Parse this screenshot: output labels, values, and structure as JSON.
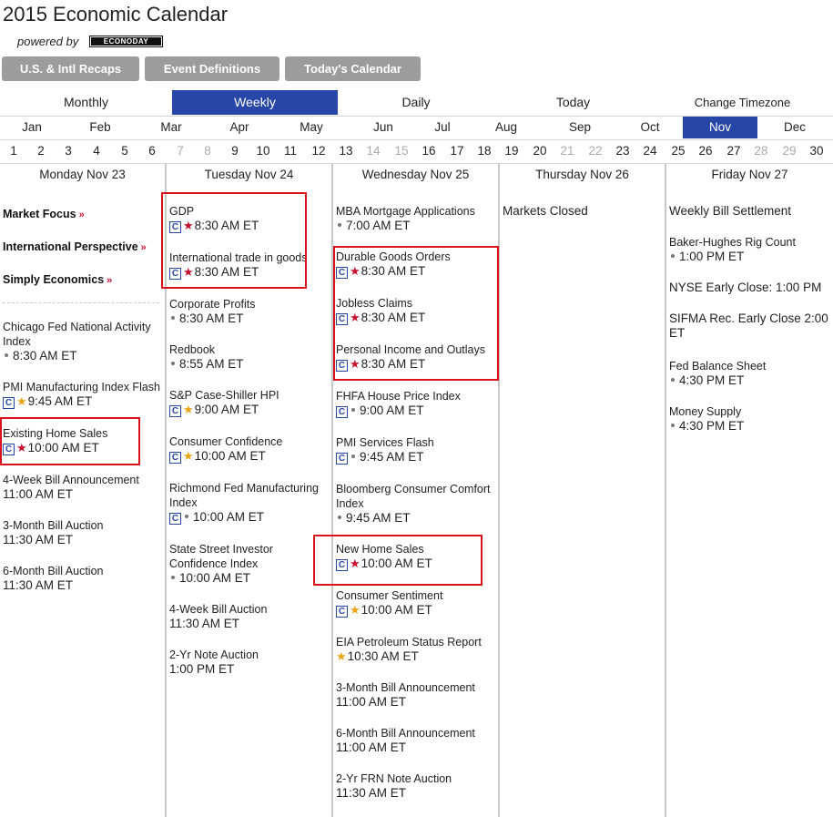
{
  "header": {
    "title": "2015 Economic Calendar",
    "powered_by": "powered by",
    "logo_text": "ECONODAY"
  },
  "buttons": {
    "recaps": "U.S. & Intl Recaps",
    "definitions": "Event Definitions",
    "todays": "Today's Calendar"
  },
  "views": {
    "monthly": "Monthly",
    "weekly": "Weekly",
    "daily": "Daily",
    "today": "Today",
    "timezone": "Change Timezone",
    "active": "Weekly"
  },
  "months": [
    "Jan",
    "Feb",
    "Mar",
    "Apr",
    "May",
    "Jun",
    "Jul",
    "Aug",
    "Sep",
    "Oct",
    "Nov",
    "Dec"
  ],
  "active_month": "Nov",
  "days": [
    "1",
    "2",
    "3",
    "4",
    "5",
    "6",
    "7",
    "8",
    "9",
    "10",
    "11",
    "12",
    "13",
    "14",
    "15",
    "16",
    "17",
    "18",
    "19",
    "20",
    "21",
    "22",
    "23",
    "24",
    "25",
    "26",
    "27",
    "28",
    "29",
    "30"
  ],
  "focus_links": {
    "market_focus": "Market Focus",
    "international": "International Perspective",
    "simply": "Simply Economics",
    "arrow": "»"
  },
  "columns": [
    {
      "header": "Monday Nov 23",
      "events": [
        {
          "name": "Chicago Fed National Activity Index",
          "time": "8:30 AM ET"
        },
        {
          "name": "PMI Manufacturing Index Flash",
          "time": "9:45 AM ET"
        },
        {
          "name": "Existing Home Sales",
          "time": "10:00 AM ET"
        },
        {
          "name": "4-Week Bill Announcement",
          "time": "11:00 AM ET"
        },
        {
          "name": "3-Month Bill Auction",
          "time": "11:30 AM ET"
        },
        {
          "name": "6-Month Bill Auction",
          "time": "11:30 AM ET"
        }
      ]
    },
    {
      "header": "Tuesday Nov 24",
      "events": [
        {
          "name": "GDP",
          "time": "8:30 AM ET"
        },
        {
          "name": "International trade in goods",
          "time": "8:30 AM ET"
        },
        {
          "name": "Corporate Profits",
          "time": "8:30 AM ET"
        },
        {
          "name": "Redbook",
          "time": "8:55 AM ET"
        },
        {
          "name": "S&P Case-Shiller HPI",
          "time": "9:00 AM ET"
        },
        {
          "name": "Consumer Confidence",
          "time": "10:00 AM ET"
        },
        {
          "name": "Richmond Fed Manufacturing Index",
          "time": "10:00 AM ET"
        },
        {
          "name": "State Street Investor Confidence Index",
          "time": "10:00 AM ET"
        },
        {
          "name": "4-Week Bill Auction",
          "time": "11:30 AM ET"
        },
        {
          "name": "2-Yr Note Auction",
          "time": "1:00 PM ET"
        }
      ]
    },
    {
      "header": "Wednesday Nov 25",
      "events": [
        {
          "name": "MBA Mortgage Applications",
          "time": "7:00 AM ET"
        },
        {
          "name": "Durable Goods Orders",
          "time": "8:30 AM ET"
        },
        {
          "name": "Jobless Claims",
          "time": "8:30 AM ET"
        },
        {
          "name": "Personal Income and Outlays",
          "time": "8:30 AM ET"
        },
        {
          "name": "FHFA House Price Index",
          "time": "9:00 AM ET"
        },
        {
          "name": "PMI Services Flash",
          "time": "9:45 AM ET"
        },
        {
          "name": "Bloomberg Consumer Comfort Index",
          "time": "9:45 AM ET"
        },
        {
          "name": "New Home Sales",
          "time": "10:00 AM ET"
        },
        {
          "name": "Consumer Sentiment",
          "time": "10:00 AM ET"
        },
        {
          "name": "EIA Petroleum Status Report",
          "time": "10:30 AM ET"
        },
        {
          "name": "3-Month Bill Announcement",
          "time": "11:00 AM ET"
        },
        {
          "name": "6-Month Bill Announcement",
          "time": "11:00 AM ET"
        },
        {
          "name": "2-Yr FRN Note Auction",
          "time": "11:30 AM ET"
        }
      ]
    },
    {
      "header": "Thursday Nov 26",
      "events": [
        {
          "name": "Markets Closed"
        }
      ]
    },
    {
      "header": "Friday Nov 27",
      "events": [
        {
          "name": "Weekly Bill Settlement"
        },
        {
          "name": "Baker-Hughes Rig Count",
          "time": "1:00 PM ET"
        },
        {
          "name": "NYSE Early Close: 1:00 PM"
        },
        {
          "name": "SIFMA Rec. Early Close 2:00 ET"
        },
        {
          "name": "Fed Balance Sheet",
          "time": "4:30 PM ET"
        },
        {
          "name": "Money Supply",
          "time": "4:30 PM ET"
        }
      ]
    }
  ],
  "icons": {
    "consensus": "C",
    "star": "★"
  },
  "colors": {
    "active_blue": "#2747a8",
    "button_gray": "#9c9c9c",
    "high_importance_star": "#c8102e",
    "medium_importance_star": "#e8a317",
    "highlight_box": "#d8121b"
  }
}
